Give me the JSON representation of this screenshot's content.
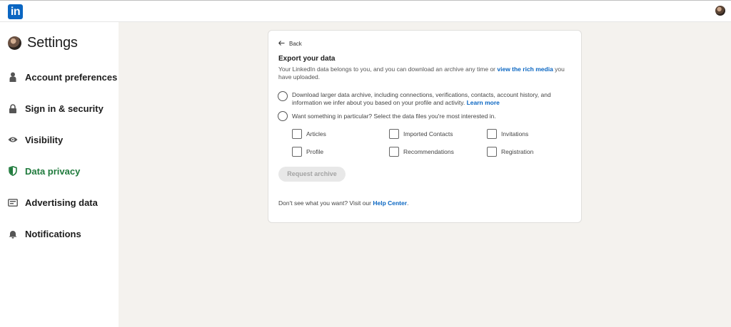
{
  "topbar": {
    "logo_text": "in",
    "brand_color": "#0a66c2"
  },
  "sidebar": {
    "title": "Settings",
    "items": [
      {
        "label": "Account preferences",
        "icon": "person-icon"
      },
      {
        "label": "Sign in & security",
        "icon": "lock-icon"
      },
      {
        "label": "Visibility",
        "icon": "eye-icon"
      },
      {
        "label": "Data privacy",
        "icon": "shield-icon",
        "active": true
      },
      {
        "label": "Advertising data",
        "icon": "ad-card-icon"
      },
      {
        "label": "Notifications",
        "icon": "bell-icon"
      }
    ],
    "active_color": "#1f7a3c"
  },
  "card": {
    "back_label": "Back",
    "title": "Export your data",
    "desc_before": "Your LinkedIn data belongs to you, and you can download an archive any time or ",
    "desc_link": "view the rich media",
    "desc_after": " you have uploaded.",
    "option1_text": "Download larger data archive, including connections, verifications, contacts, account history, and information we infer about you based on your profile and activity. ",
    "option1_link": "Learn more",
    "option2_text": "Want something in particular? Select the data files you're most interested in.",
    "checkboxes": [
      "Articles",
      "Imported Contacts",
      "Invitations",
      "Profile",
      "Recommendations",
      "Registration"
    ],
    "request_button": "Request archive",
    "footer_before": "Don't see what you want? Visit our ",
    "footer_link": "Help Center",
    "footer_after": "."
  }
}
